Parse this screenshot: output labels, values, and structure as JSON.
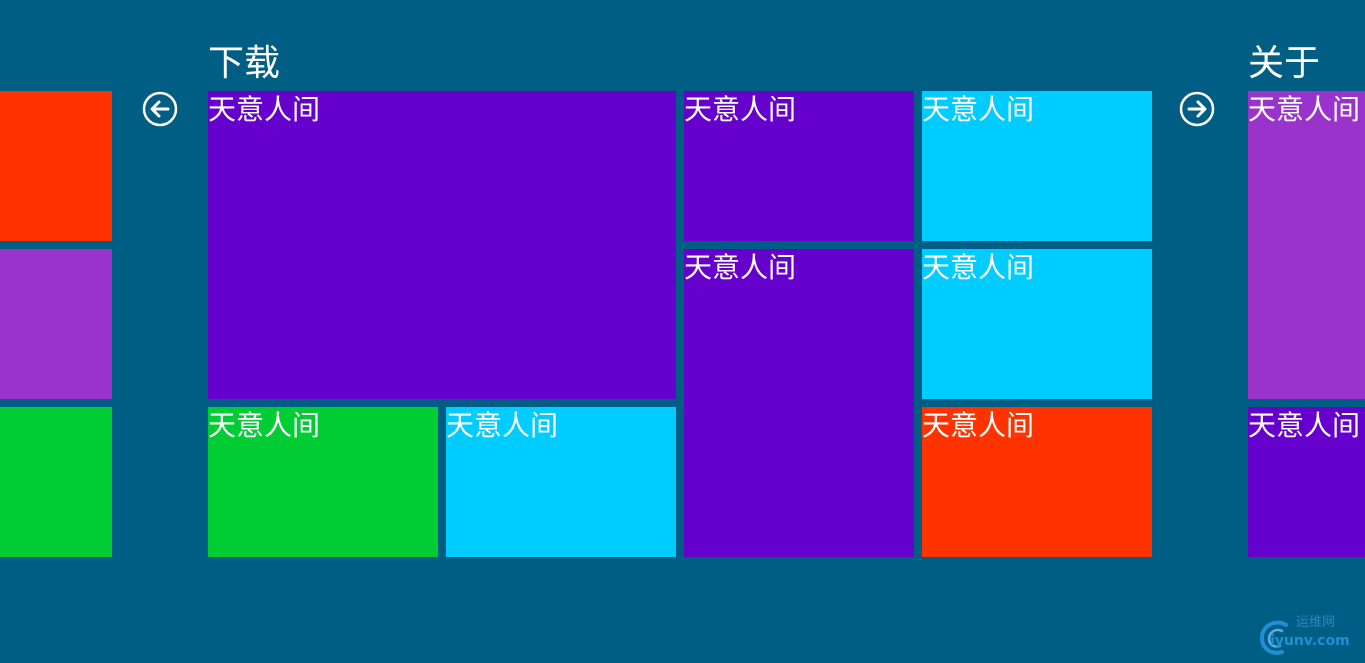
{
  "colors": {
    "background": "#005E85",
    "red": "#FF3300",
    "purple": "#9933CC",
    "green": "#00CC33",
    "violet": "#6600CC",
    "cyan": "#00CCFF"
  },
  "left_group": {
    "tiles": [
      {
        "color": "#FF3300"
      },
      {
        "color": "#9933CC"
      },
      {
        "color": "#00CC33"
      }
    ]
  },
  "nav": {
    "back_icon": "arrow-left-circle-icon",
    "forward_icon": "arrow-right-circle-icon"
  },
  "download_group": {
    "title": "下载",
    "tiles": [
      {
        "label": "天意人间",
        "color": "#6600CC"
      },
      {
        "label": "天意人间",
        "color": "#00CC33"
      },
      {
        "label": "天意人间",
        "color": "#00CCFF"
      },
      {
        "label": "天意人间",
        "color": "#6600CC"
      },
      {
        "label": "天意人间",
        "color": "#6600CC"
      },
      {
        "label": "天意人间",
        "color": "#00CCFF"
      },
      {
        "label": "天意人间",
        "color": "#00CCFF"
      },
      {
        "label": "天意人间",
        "color": "#FF3300"
      }
    ]
  },
  "about_group": {
    "title": "关于",
    "tiles": [
      {
        "label": "天意人间",
        "color": "#9933CC"
      },
      {
        "label": "天意人间",
        "color": "#6600CC"
      }
    ]
  },
  "watermark": {
    "title": "运维网",
    "domain": "iyunv.com"
  }
}
